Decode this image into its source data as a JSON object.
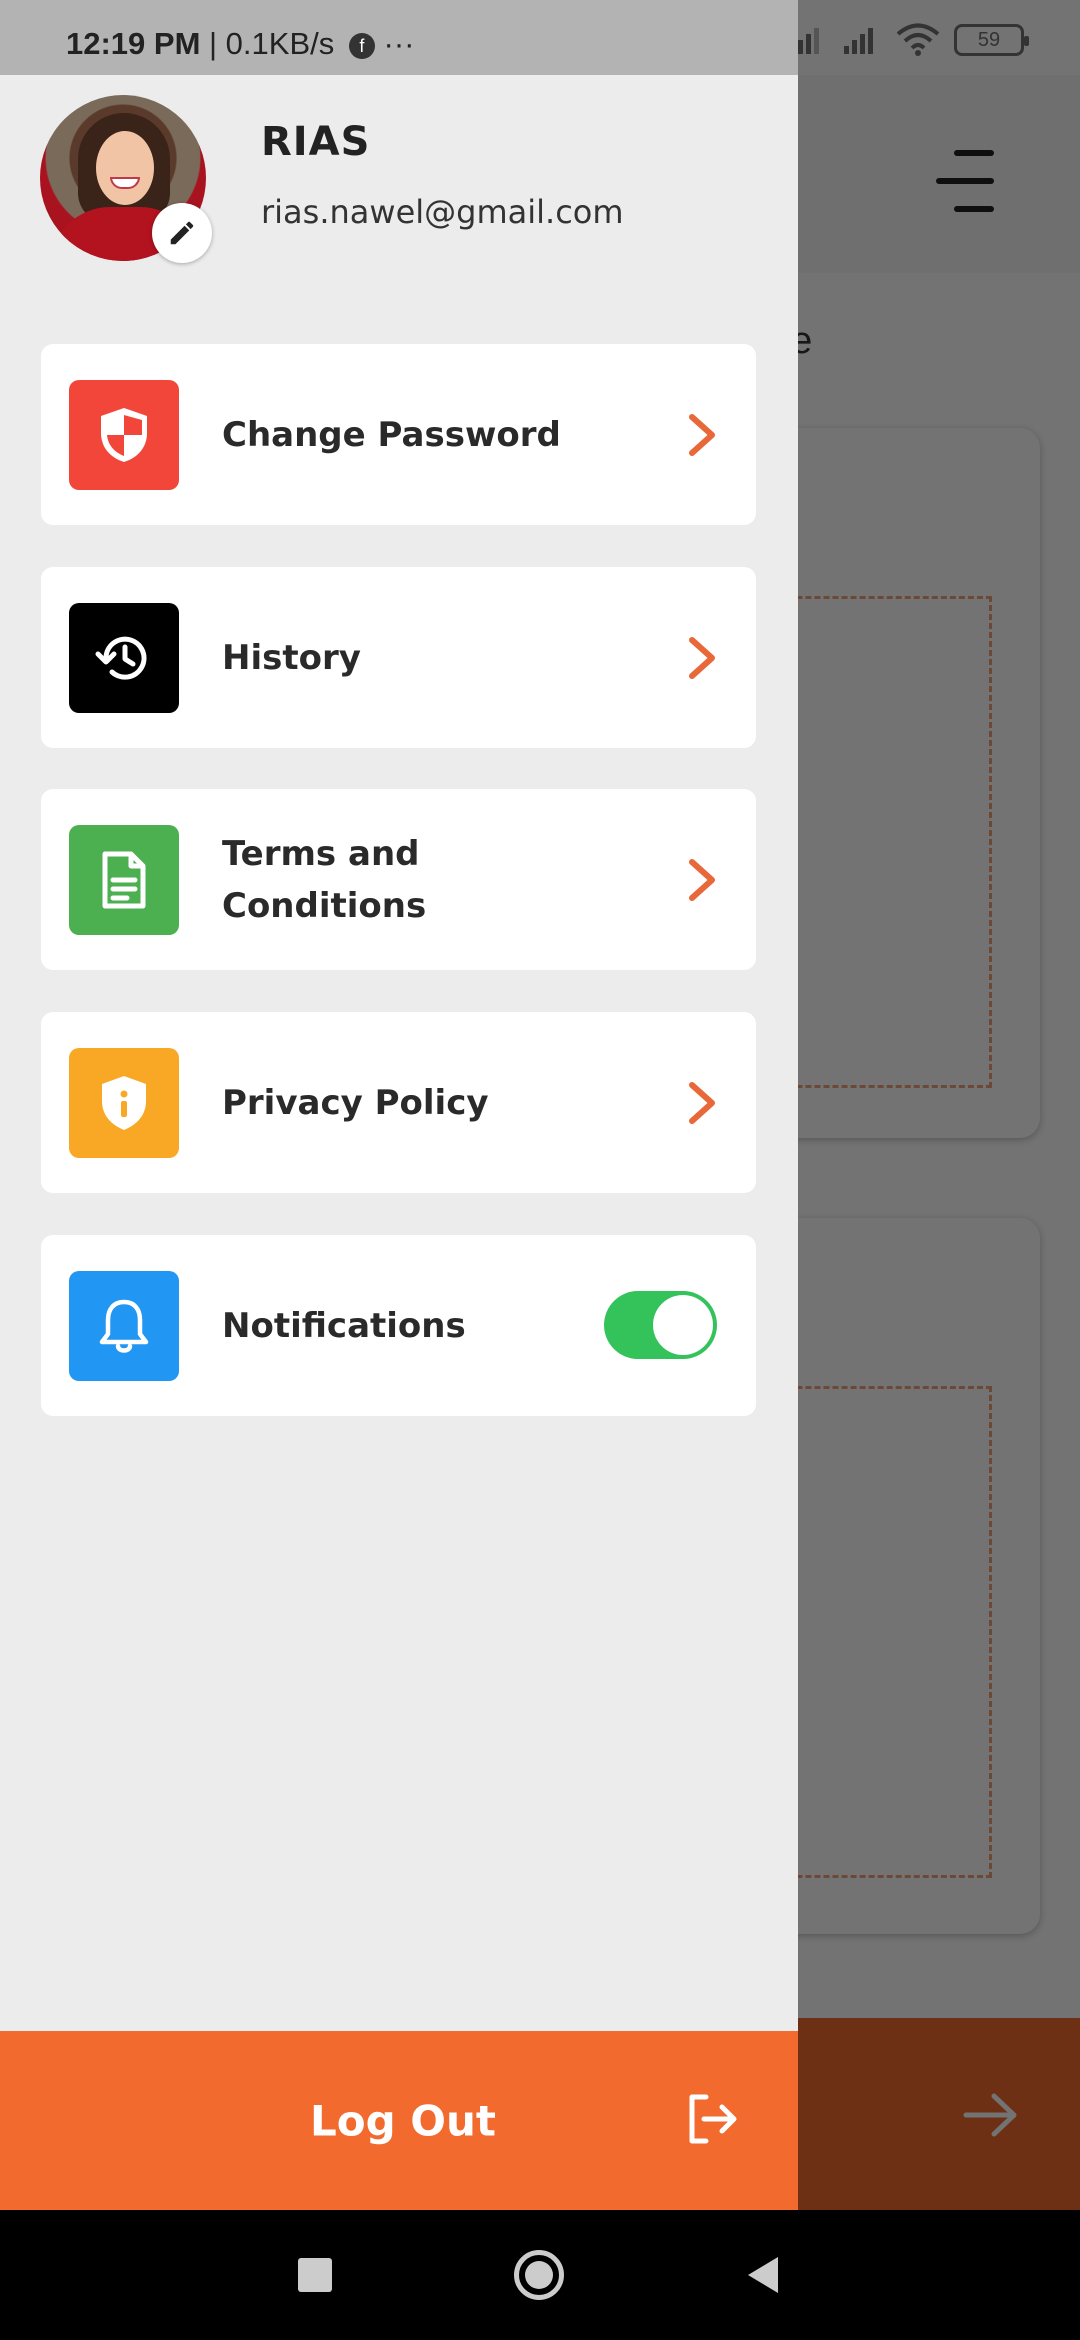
{
  "status_bar": {
    "time": "12:19 PM",
    "net_speed": " | 0.1KB/s",
    "extra": "···",
    "battery": "59"
  },
  "profile": {
    "name": "RIAS",
    "email": "rias.nawel@gmail.com"
  },
  "menu": {
    "items": [
      {
        "label": "Change Password",
        "icon": "shield-icon",
        "color": "#f2463a"
      },
      {
        "label": "History",
        "icon": "history-icon",
        "color": "#000000"
      },
      {
        "label": "Terms and Conditions",
        "icon": "document-icon",
        "color": "#4caf50"
      },
      {
        "label": "Privacy Policy",
        "icon": "privacy-shield-icon",
        "color": "#f9a825"
      }
    ],
    "notifications": {
      "label": "Notifications",
      "icon": "bell-icon",
      "color": "#2196f3",
      "enabled": true
    }
  },
  "logout": {
    "label": "Log Out"
  },
  "background": {
    "partial_text": "ue"
  },
  "colors": {
    "accent": "#f26a2e",
    "chevron": "#e8683a",
    "toggle_on": "#34c25a"
  }
}
